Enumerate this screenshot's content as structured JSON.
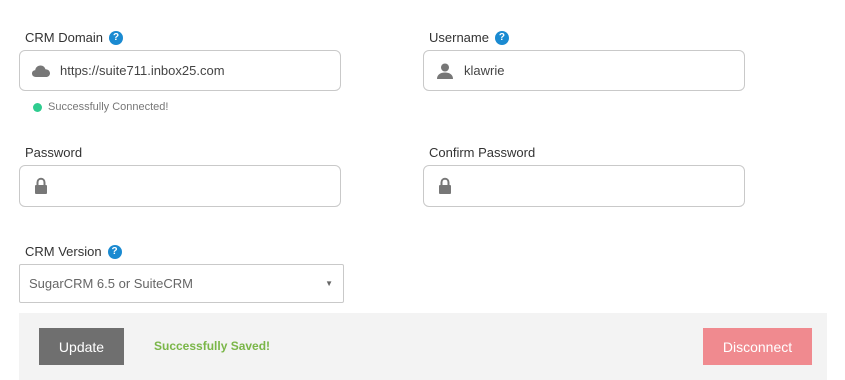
{
  "crm_domain": {
    "label": "CRM Domain",
    "value": "https://suite711.inbox25.com",
    "icon": "cloud-icon",
    "status": "Successfully Connected!",
    "status_color": "#2ecc8f"
  },
  "username": {
    "label": "Username",
    "value": "klawrie",
    "icon": "user-icon"
  },
  "password": {
    "label": "Password",
    "value": "",
    "icon": "lock-icon"
  },
  "confirm_password": {
    "label": "Confirm Password",
    "value": "",
    "icon": "lock-icon"
  },
  "crm_version": {
    "label": "CRM Version",
    "selected": "SugarCRM 6.5 or SuiteCRM"
  },
  "help_glyph": "?",
  "footer": {
    "update_label": "Update",
    "saved_message": "Successfully Saved!",
    "disconnect_label": "Disconnect"
  },
  "colors": {
    "help": "#1a8ad1",
    "update_button": "#6f6f6f",
    "disconnect_button": "#f08a8f",
    "saved_text": "#7ab648"
  }
}
